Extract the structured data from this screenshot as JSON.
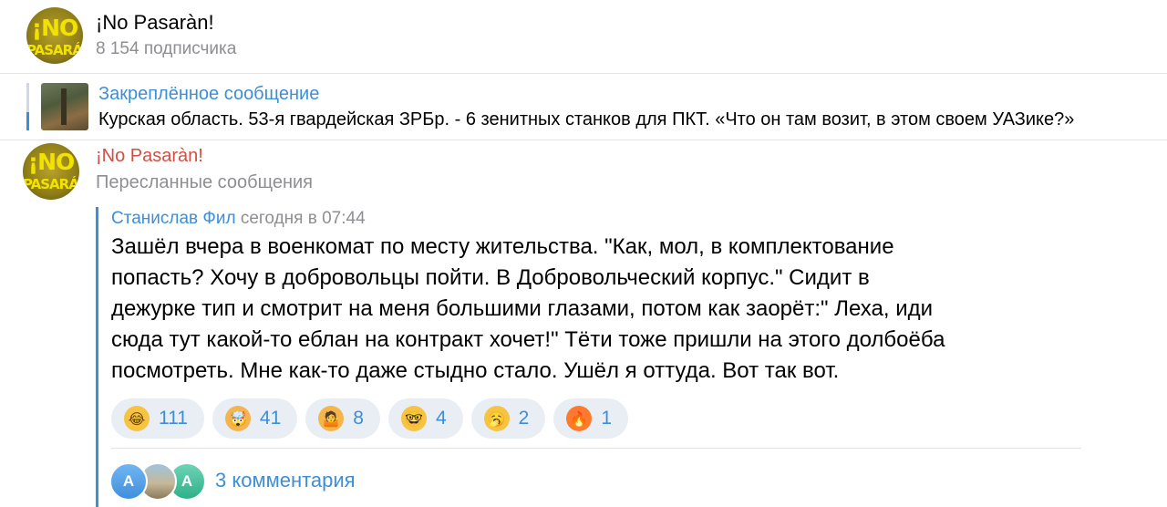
{
  "header": {
    "logo_line1": "¡NO",
    "logo_line2": "PASARÁN",
    "title": "¡No Pasaràn!",
    "subscribers": "8 154 подписчика"
  },
  "pinned": {
    "label": "Закреплённое сообщение",
    "text": "Курская область. 53-я гвардейская ЗРБр. - 6 зенитных станков для ПКТ.  «Что он там возит, в этом своем УАЗике?»"
  },
  "post": {
    "author": "¡No Pasaràn!",
    "forwarded_label": "Пересланные сообщения",
    "forward": {
      "name": "Станислав Фил",
      "date": "сегодня в 07:44",
      "text": "Зашёл вчера в военкомат по месту жительства. \"Как, мол, в комплектование\nпопасть? Хочу в добровольцы пойти. В Добровольческий корпус.\"  Сидит в\nдежурке тип и смотрит на меня большими глазами, потом как заорёт:\" Леха, иди\nсюда тут какой-то еблан на контракт хочет!\"  Тёти тоже пришли на этого долбоёба\nпосмотреть. Мне как-то даже стыдно стало. Ушёл я оттуда. Вот так вот."
    },
    "reactions": [
      {
        "icon": "rolling-on-floor-laughing-emoji",
        "glyph": "😂",
        "bg": "#f6c343",
        "count": "111"
      },
      {
        "icon": "exploding-head-emoji",
        "glyph": "🤯",
        "bg": "#f5b450",
        "count": "41"
      },
      {
        "icon": "person-shrugging-emoji",
        "glyph": "🤷",
        "bg": "#f2b64a",
        "count": "8"
      },
      {
        "icon": "nerd-face-emoji",
        "glyph": "🤓",
        "bg": "#f6c343",
        "count": "4"
      },
      {
        "icon": "yawning-face-emoji",
        "glyph": "🥱",
        "bg": "#f6c343",
        "count": "2"
      },
      {
        "icon": "fire-emoji",
        "glyph": "🔥",
        "bg": "#ff7a2e",
        "count": "1"
      }
    ],
    "commenters": [
      "A",
      "",
      "A"
    ],
    "comments_label": "3 комментария"
  },
  "colors": {
    "accent": "#3d8ed6",
    "channel_name": "#d24e42",
    "secondary_text": "#8e8e93",
    "reaction_bg": "#e9eef4"
  }
}
